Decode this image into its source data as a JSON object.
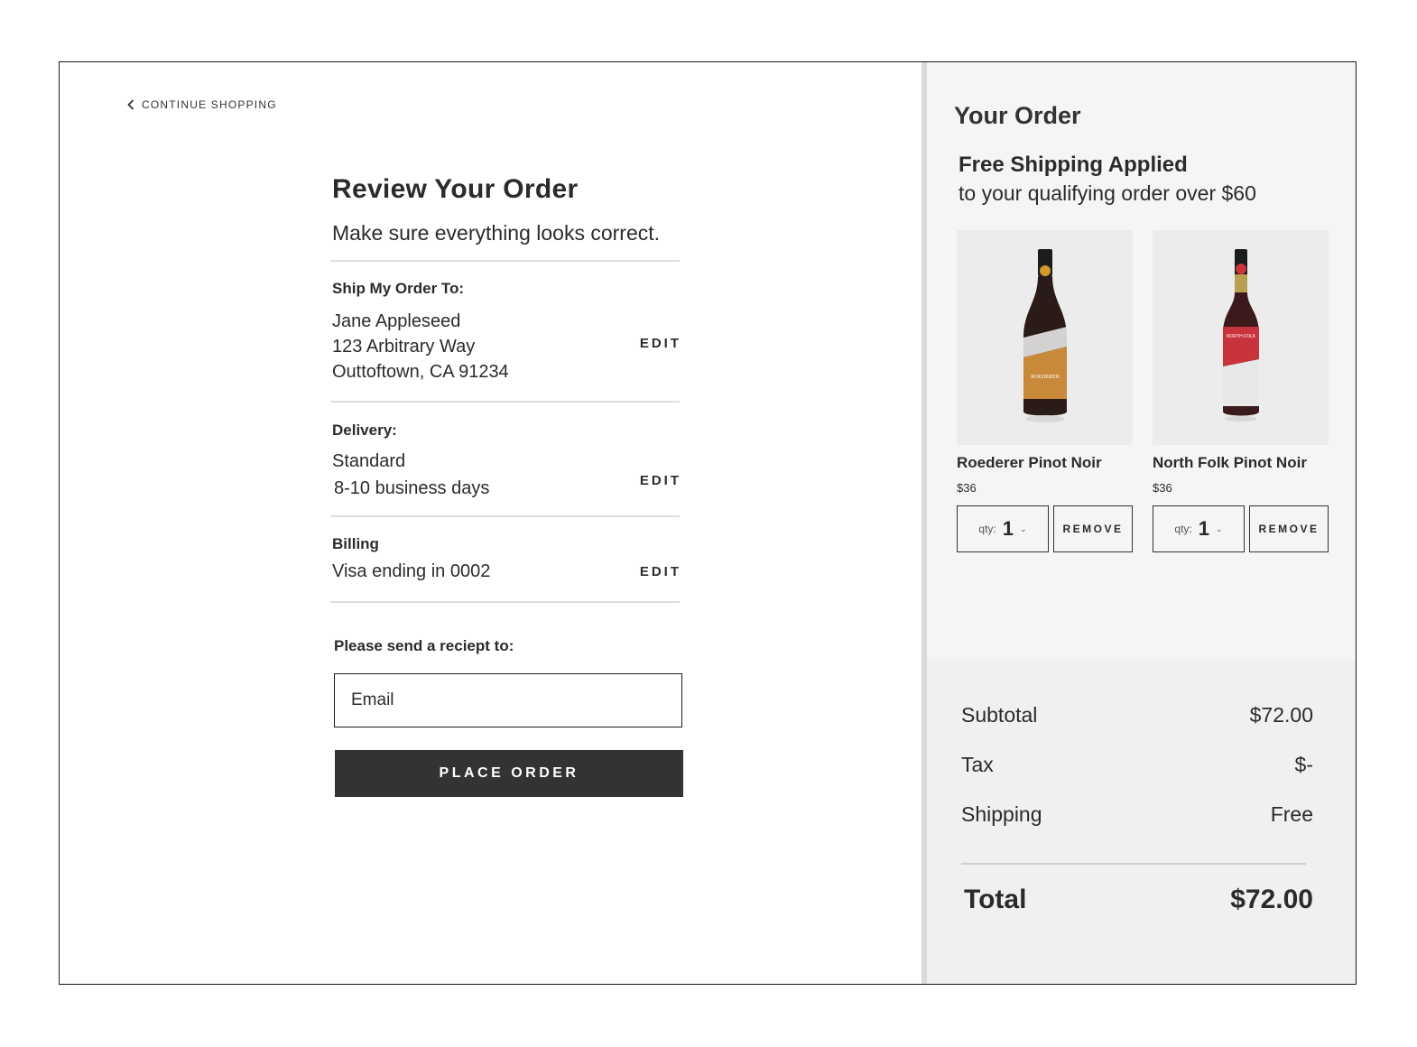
{
  "nav": {
    "continue_label": "CONTINUE SHOPPING"
  },
  "review": {
    "title": "Review Your Order",
    "subtitle": "Make sure everything looks correct.",
    "ship": {
      "label": "Ship My Order To:",
      "lines": [
        "Jane Appleseed",
        "123 Arbitrary Way",
        "Outtoftown, CA 91234"
      ],
      "edit": "EDIT"
    },
    "delivery": {
      "label": "Delivery:",
      "lines": [
        "Standard",
        "8-10 business days"
      ],
      "edit": "EDIT"
    },
    "billing": {
      "label": "Billing",
      "lines": [
        "Visa ending in 0002"
      ],
      "edit": "EDIT"
    },
    "receipt_label": "Please send a reciept to:",
    "email_placeholder": "Email",
    "place_order": "PLACE ORDER"
  },
  "order": {
    "title": "Your Order",
    "shipping_title": "Free Shipping Applied",
    "shipping_sub": "to your qualifying order over $60",
    "products": [
      {
        "name": "Roederer Pinot Noir",
        "price": "$36",
        "qty_label": "qty:",
        "qty": "1",
        "remove": "REMOVE",
        "label_color": "#c8893a",
        "cap_color": "#d19a2c",
        "bottle_label": "ROEDERER"
      },
      {
        "name": "North Folk Pinot Noir",
        "price": "$36",
        "qty_label": "qty:",
        "qty": "1",
        "remove": "REMOVE",
        "label_color": "#c9333c",
        "cap_color": "#c9333c",
        "bottle_label": "NORTH FOLK"
      }
    ],
    "summary": {
      "subtotal_label": "Subtotal",
      "subtotal": "$72.00",
      "tax_label": "Tax",
      "tax": "$-",
      "shipping_label": "Shipping",
      "shipping": "Free",
      "total_label": "Total",
      "total": "$72.00"
    }
  },
  "colors": {
    "button_bg": "#323432",
    "panel_bg": "#f5f5f5",
    "summary_bg": "#f0f0f0"
  }
}
